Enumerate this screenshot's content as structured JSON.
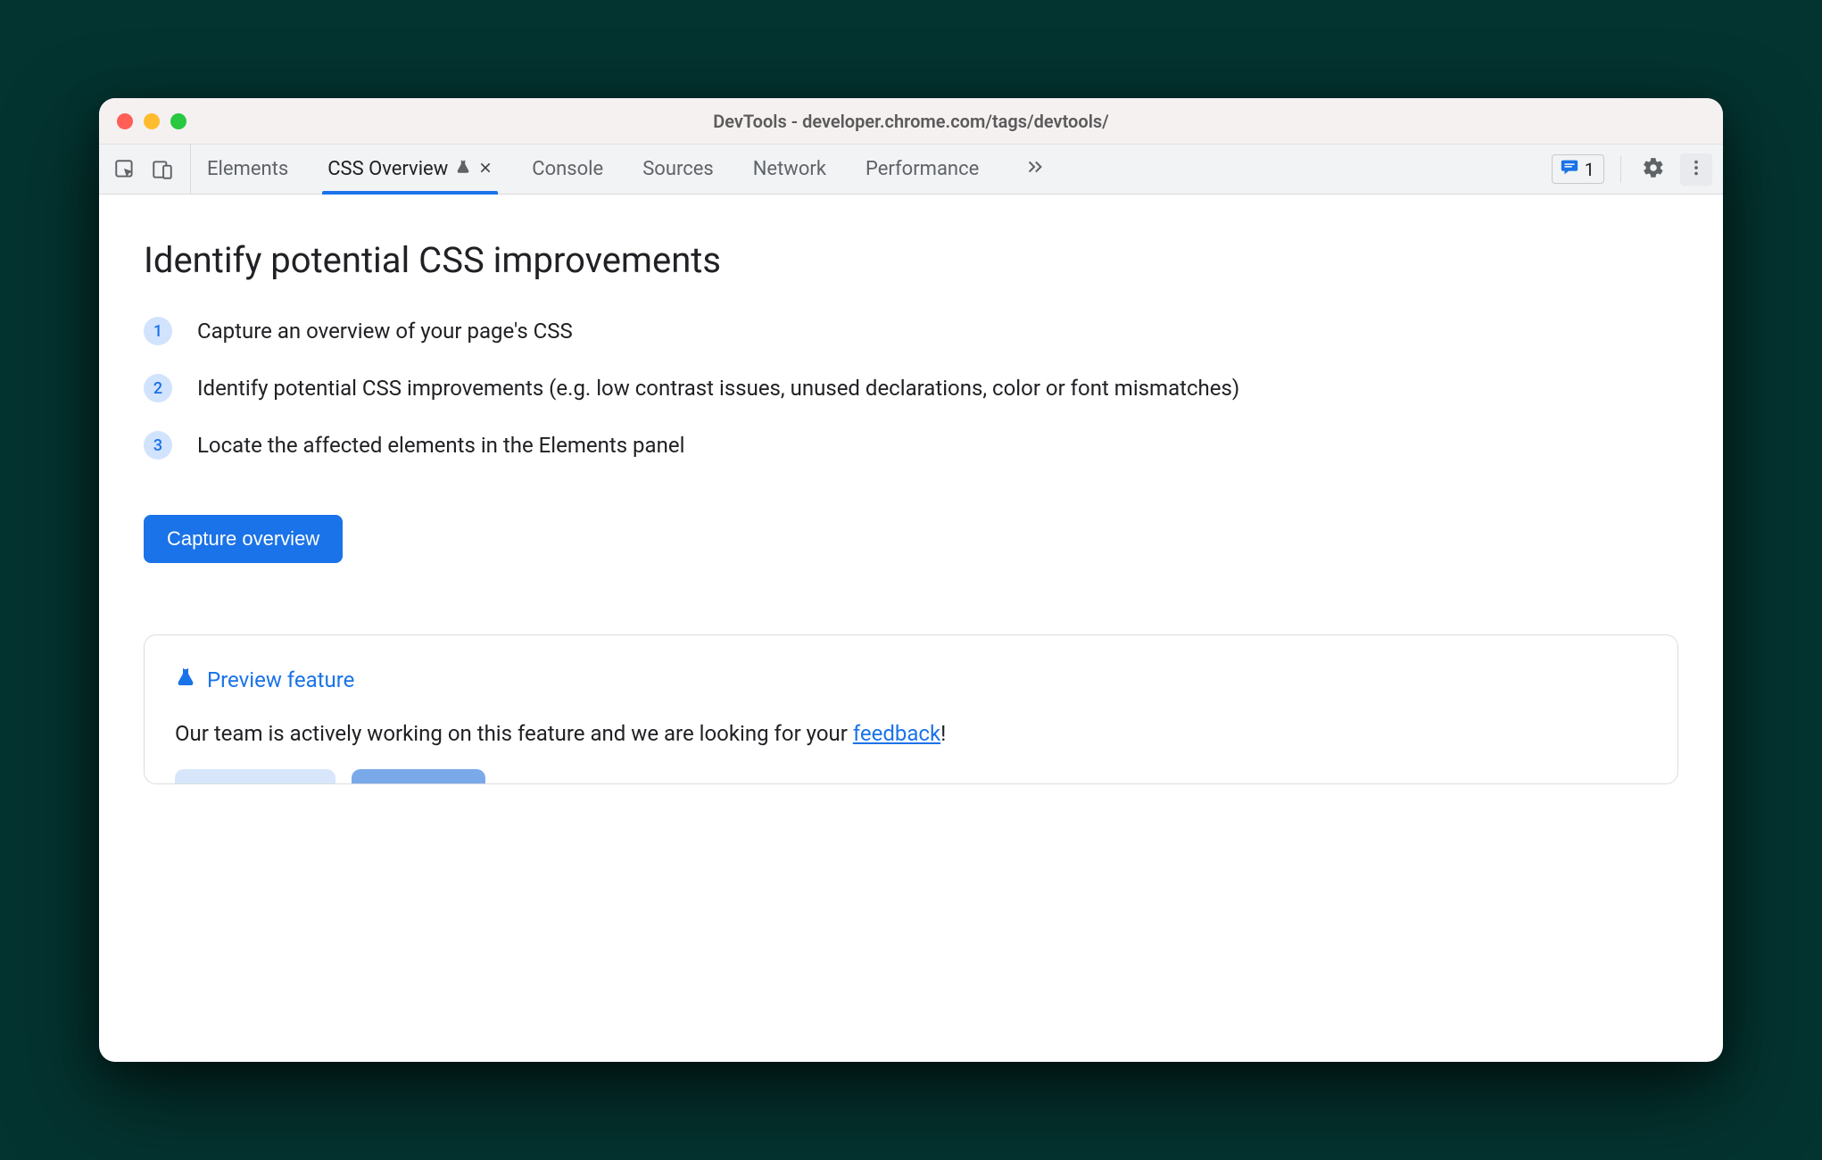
{
  "window": {
    "title": "DevTools - developer.chrome.com/tags/devtools/"
  },
  "tabs": {
    "items": [
      {
        "label": "Elements"
      },
      {
        "label": "CSS Overview",
        "active": true,
        "experimental": true,
        "closable": true
      },
      {
        "label": "Console"
      },
      {
        "label": "Sources"
      },
      {
        "label": "Network"
      },
      {
        "label": "Performance"
      }
    ]
  },
  "toolbar": {
    "issues_count": "1"
  },
  "main": {
    "heading": "Identify potential CSS improvements",
    "steps": [
      "Capture an overview of your page's CSS",
      "Identify potential CSS improvements (e.g. low contrast issues, unused declarations, color or font mismatches)",
      "Locate the affected elements in the Elements panel"
    ],
    "capture_button": "Capture overview"
  },
  "preview": {
    "title": "Preview feature",
    "body_prefix": "Our team is actively working on this feature and we are looking for your ",
    "link_text": "feedback",
    "body_suffix": "!"
  },
  "icons": {
    "inspect": "inspect-element-icon",
    "device": "device-toolbar-icon",
    "flask": "experimental-flask-icon",
    "close": "close-icon",
    "more_tabs": "chevron-double-right-icon",
    "message": "message-icon",
    "gear": "gear-icon",
    "kebab": "kebab-menu-icon"
  },
  "colors": {
    "accent": "#1a73e8",
    "step_bg": "#d2e3fd",
    "toolbar_bg": "#f1f3f4",
    "titlebar_bg": "#f6f1f1"
  }
}
